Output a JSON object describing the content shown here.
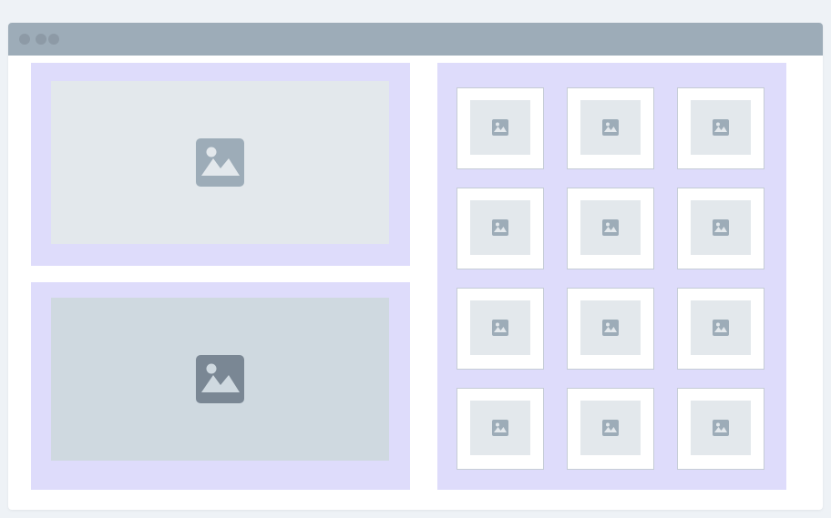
{
  "window": {
    "controls": [
      "window-dot-icon",
      "window-dot-icon",
      "window-dot-icon"
    ]
  },
  "colors": {
    "page_background": "#eef2f6",
    "titlebar": "#9dacb8",
    "panel": "#dedcfb",
    "placeholder_light": "#e3e8ec",
    "placeholder_dark": "#cfd9e0",
    "icon_light": "#9dacb8",
    "icon_dark": "#7a8794"
  },
  "left_column": {
    "top_media": {
      "icon": "image-icon"
    },
    "bottom_media": {
      "icon": "image-icon"
    }
  },
  "grid": {
    "rows": 4,
    "columns": 3,
    "tiles": [
      {
        "icon": "image-icon"
      },
      {
        "icon": "image-icon"
      },
      {
        "icon": "image-icon"
      },
      {
        "icon": "image-icon"
      },
      {
        "icon": "image-icon"
      },
      {
        "icon": "image-icon"
      },
      {
        "icon": "image-icon"
      },
      {
        "icon": "image-icon"
      },
      {
        "icon": "image-icon"
      },
      {
        "icon": "image-icon"
      },
      {
        "icon": "image-icon"
      },
      {
        "icon": "image-icon"
      }
    ]
  }
}
